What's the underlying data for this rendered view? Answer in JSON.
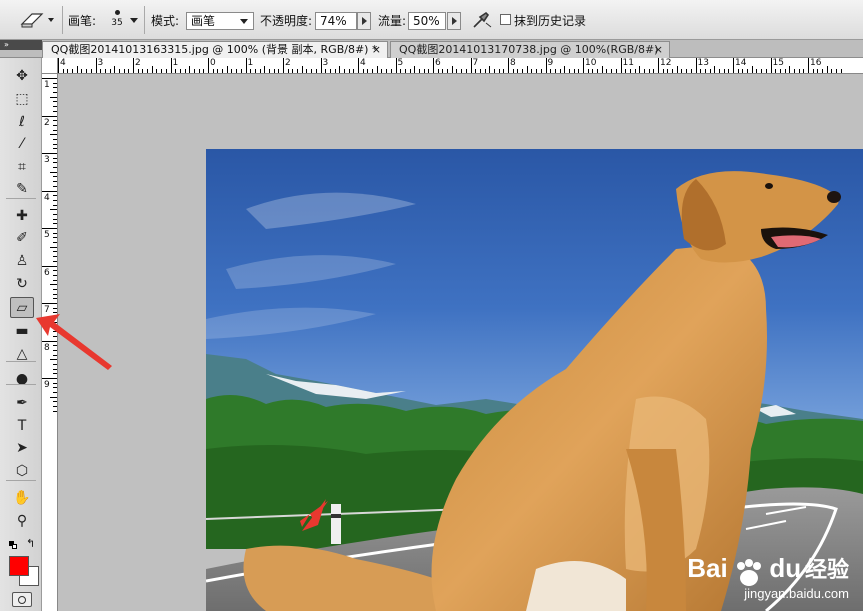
{
  "options_bar": {
    "brush_label": "画笔:",
    "brush_size": "35",
    "mode_label": "模式:",
    "mode_value": "画笔",
    "opacity_label": "不透明度:",
    "opacity_value": "74%",
    "flow_label": "流量:",
    "flow_value": "50%",
    "erase_history_label": "抹到历史记录"
  },
  "tabs": [
    {
      "label": "QQ截图20141013163315.jpg @ 100% (背景 副本, RGB/8#) *",
      "active": true
    },
    {
      "label": "QQ截图20141013170738.jpg @ 100%(RGB/8#)",
      "active": false
    }
  ],
  "tab_close_glyph": "×",
  "panel_collapse_glyph": "»",
  "ruler": {
    "h_labels": [
      "4",
      "3",
      "2",
      "1",
      "0",
      "1",
      "2",
      "3",
      "4",
      "5",
      "6",
      "7",
      "8",
      "9",
      "10",
      "11",
      "12",
      "13",
      "14",
      "15",
      "16"
    ],
    "v_labels": [
      "1",
      "2",
      "3",
      "4",
      "5",
      "6",
      "7",
      "8",
      "9"
    ]
  },
  "toolbox": {
    "tools": [
      {
        "name": "move-tool-icon",
        "glyph": "✥"
      },
      {
        "name": "marquee-tool-icon",
        "glyph": "⬚"
      },
      {
        "name": "lasso-tool-icon",
        "glyph": "ℓ"
      },
      {
        "name": "quick-selection-tool-icon",
        "glyph": "⁄"
      },
      {
        "name": "crop-tool-icon",
        "glyph": "⌗"
      },
      {
        "name": "eyedropper-tool-icon",
        "glyph": "✎"
      },
      {
        "name": "healing-brush-tool-icon",
        "glyph": "✚"
      },
      {
        "name": "brush-tool-icon",
        "glyph": "✐"
      },
      {
        "name": "clone-stamp-tool-icon",
        "glyph": "♙"
      },
      {
        "name": "history-brush-tool-icon",
        "glyph": "↻"
      },
      {
        "name": "eraser-tool-icon",
        "glyph": "▱"
      },
      {
        "name": "gradient-tool-icon",
        "glyph": "▬"
      },
      {
        "name": "blur-tool-icon",
        "glyph": "△"
      },
      {
        "name": "dodge-tool-icon",
        "glyph": "●"
      },
      {
        "name": "pen-tool-icon",
        "glyph": "✒"
      },
      {
        "name": "type-tool-icon",
        "glyph": "T"
      },
      {
        "name": "path-selection-tool-icon",
        "glyph": "➤"
      },
      {
        "name": "shape-tool-icon",
        "glyph": "⬡"
      },
      {
        "name": "hand-tool-icon",
        "glyph": "✋"
      },
      {
        "name": "zoom-tool-icon",
        "glyph": "⚲"
      }
    ],
    "selected_tool": "eraser-tool-icon",
    "foreground_color": "#ff0000",
    "background_color": "#ffffff",
    "swap_glyph": "↰"
  },
  "watermark": {
    "logo_left": "Bai",
    "logo_right": "du",
    "tagline": "经验",
    "url": "jingyan.baidu.com"
  },
  "colors": {
    "annotation_arrow": "#e8382f",
    "sky_top": "#2a57a6",
    "sky_bottom": "#6d9ad8",
    "forest": "#2f7a2a",
    "road": "#8e8e8e"
  }
}
